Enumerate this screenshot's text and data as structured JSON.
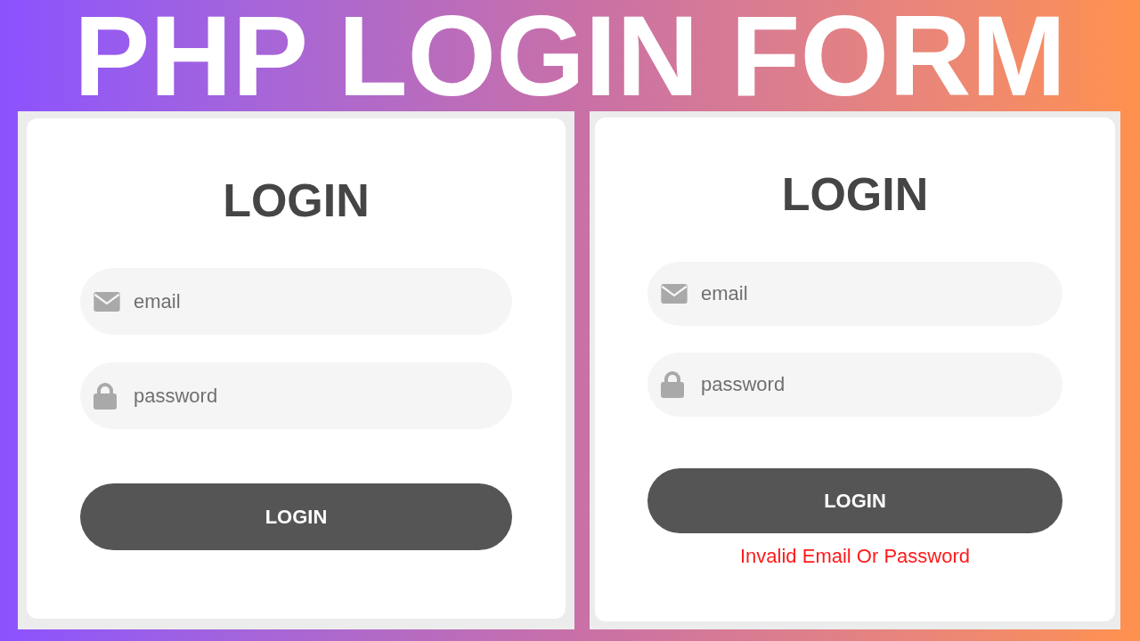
{
  "title": "PHP LOGIN FORM",
  "panels": [
    {
      "heading": "LOGIN",
      "fields": [
        {
          "kind": "email",
          "placeholder": "email"
        },
        {
          "kind": "password",
          "placeholder": "password"
        }
      ],
      "button": "LOGIN"
    },
    {
      "heading": "LOGIN",
      "fields": [
        {
          "kind": "email",
          "placeholder": "email"
        },
        {
          "kind": "password",
          "placeholder": "password"
        }
      ],
      "button": "LOGIN",
      "error": "Invalid Email Or Password"
    }
  ]
}
